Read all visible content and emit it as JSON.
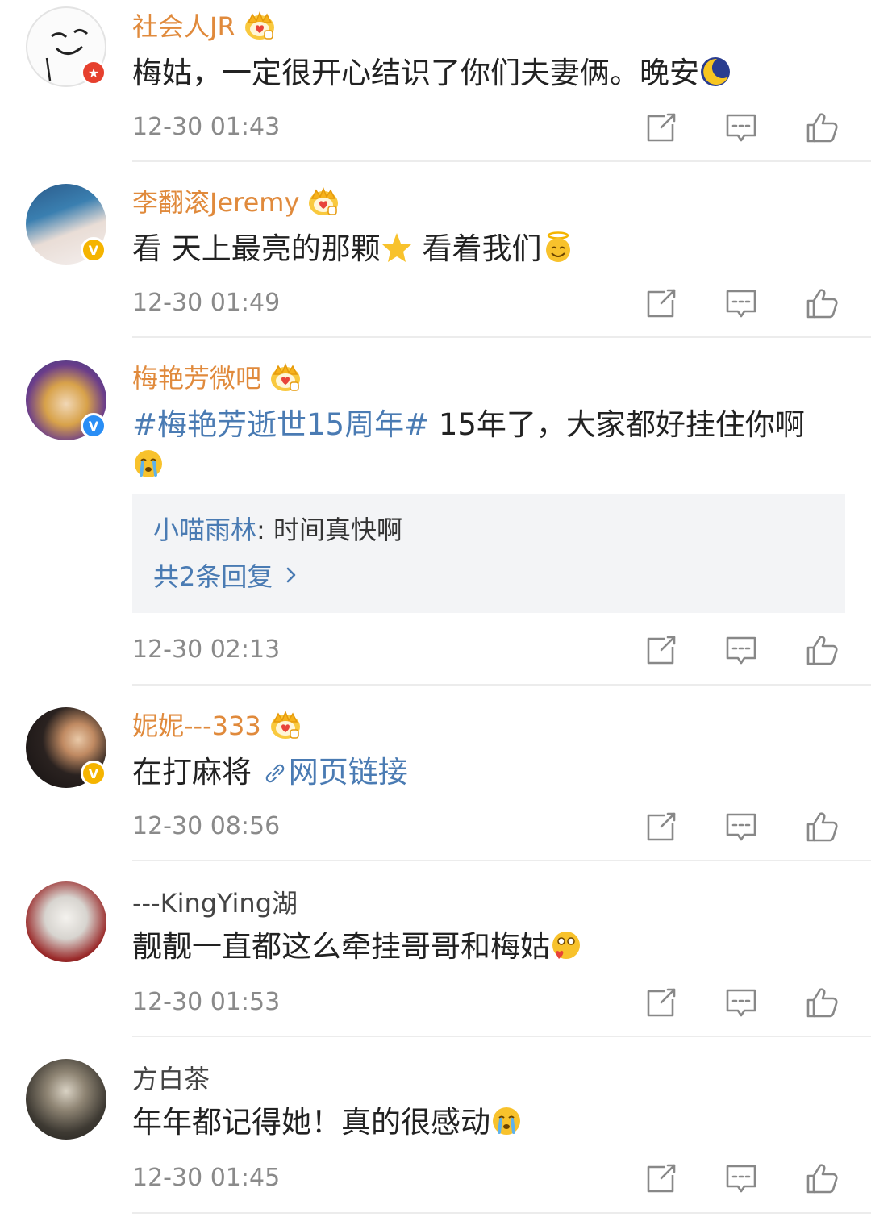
{
  "comments": [
    {
      "username": "社会人JR",
      "text": "梅姑，一定很开心结识了你们夫妻俩。晚安",
      "emoji": "moon-face-emoji",
      "time": "12-30 01:43",
      "badge": "red-star"
    },
    {
      "username": "李翻滚Jeremy",
      "text_a": "看 天上最亮的那颗",
      "text_b": " 看着我们",
      "time": "12-30 01:49",
      "badge": "gold-v"
    },
    {
      "username": "梅艳芳微吧",
      "topic": "#梅艳芳逝世15周年#",
      "text": " 15年了，大家都好挂住你啊",
      "time": "12-30 02:13",
      "badge": "blue-v",
      "reply": {
        "name": "小喵雨林",
        "text": ": 时间真快啊",
        "more": "共2条回复"
      }
    },
    {
      "username": "妮妮---333",
      "text": "在打麻将 ",
      "link": "网页链接",
      "time": "12-30 08:56",
      "badge": "gold-v"
    },
    {
      "username": "---KingYing湖",
      "text": "靓靓一直都这么牵挂哥哥和梅姑",
      "time": "12-30 01:53"
    },
    {
      "username": "方白茶",
      "text": "年年都记得她！真的很感动",
      "time": "12-30 01:45"
    }
  ],
  "icons": {
    "share": "share-icon",
    "comment": "comment-icon",
    "like": "like-icon",
    "crown": "vip-crown-icon"
  },
  "colors": {
    "username_vip": "#e08a3c",
    "link": "#4a7bb3",
    "time": "#8a8a8a"
  }
}
